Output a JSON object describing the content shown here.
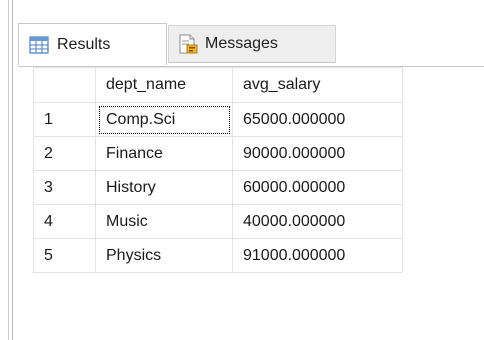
{
  "tabs": [
    {
      "label": "Results",
      "icon": "grid-icon",
      "active": true
    },
    {
      "label": "Messages",
      "icon": "messages-icon",
      "active": false
    }
  ],
  "grid": {
    "columns": [
      "",
      "dept_name",
      "avg_salary"
    ],
    "rows": [
      {
        "num": "1",
        "dept_name": "Comp.Sci",
        "avg_salary": "65000.000000"
      },
      {
        "num": "2",
        "dept_name": "Finance",
        "avg_salary": "90000.000000"
      },
      {
        "num": "3",
        "dept_name": "History",
        "avg_salary": "60000.000000"
      },
      {
        "num": "4",
        "dept_name": "Music",
        "avg_salary": "40000.000000"
      },
      {
        "num": "5",
        "dept_name": "Physics",
        "avg_salary": "91000.000000"
      }
    ],
    "selected_cell": {
      "row": 0,
      "column": "dept_name"
    }
  },
  "colors": {
    "grid_border": "#e3e3e3",
    "tab_border": "#c8c8c8",
    "inactive_tab_bg": "#eeeeee",
    "icon_blue": "#4a7ebb"
  }
}
